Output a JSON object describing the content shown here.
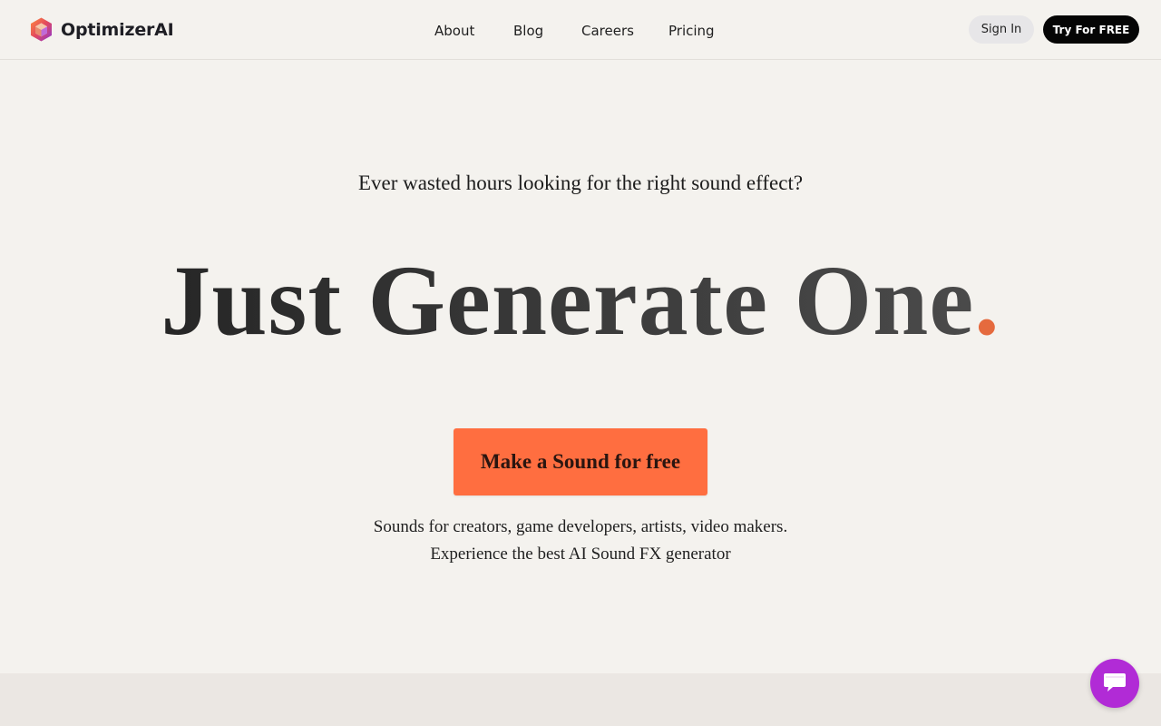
{
  "brand": {
    "name": "OptimizerAI",
    "logo_icon": "hexagon-cube-icon"
  },
  "nav": {
    "links": [
      "About",
      "Blog",
      "Careers",
      "Pricing"
    ]
  },
  "header_actions": {
    "sign_in": "Sign In",
    "try_free": "Try For FREE"
  },
  "hero": {
    "subheading": "Ever wasted hours looking for the right sound effect?",
    "headline": "Just Generate One",
    "headline_dot": ".",
    "cta": "Make a Sound for free",
    "description_line1": "Sounds for creators, game developers, artists, video makers.",
    "description_line2": "Experience the best AI Sound FX generator"
  },
  "chat": {
    "icon": "chat-bubble-icon"
  },
  "colors": {
    "background": "#f4f2ee",
    "accent": "#ff6e40",
    "headline_dot": "#e56a3e",
    "chat_launcher": "#b12bd6",
    "primary_button": "#050505"
  }
}
